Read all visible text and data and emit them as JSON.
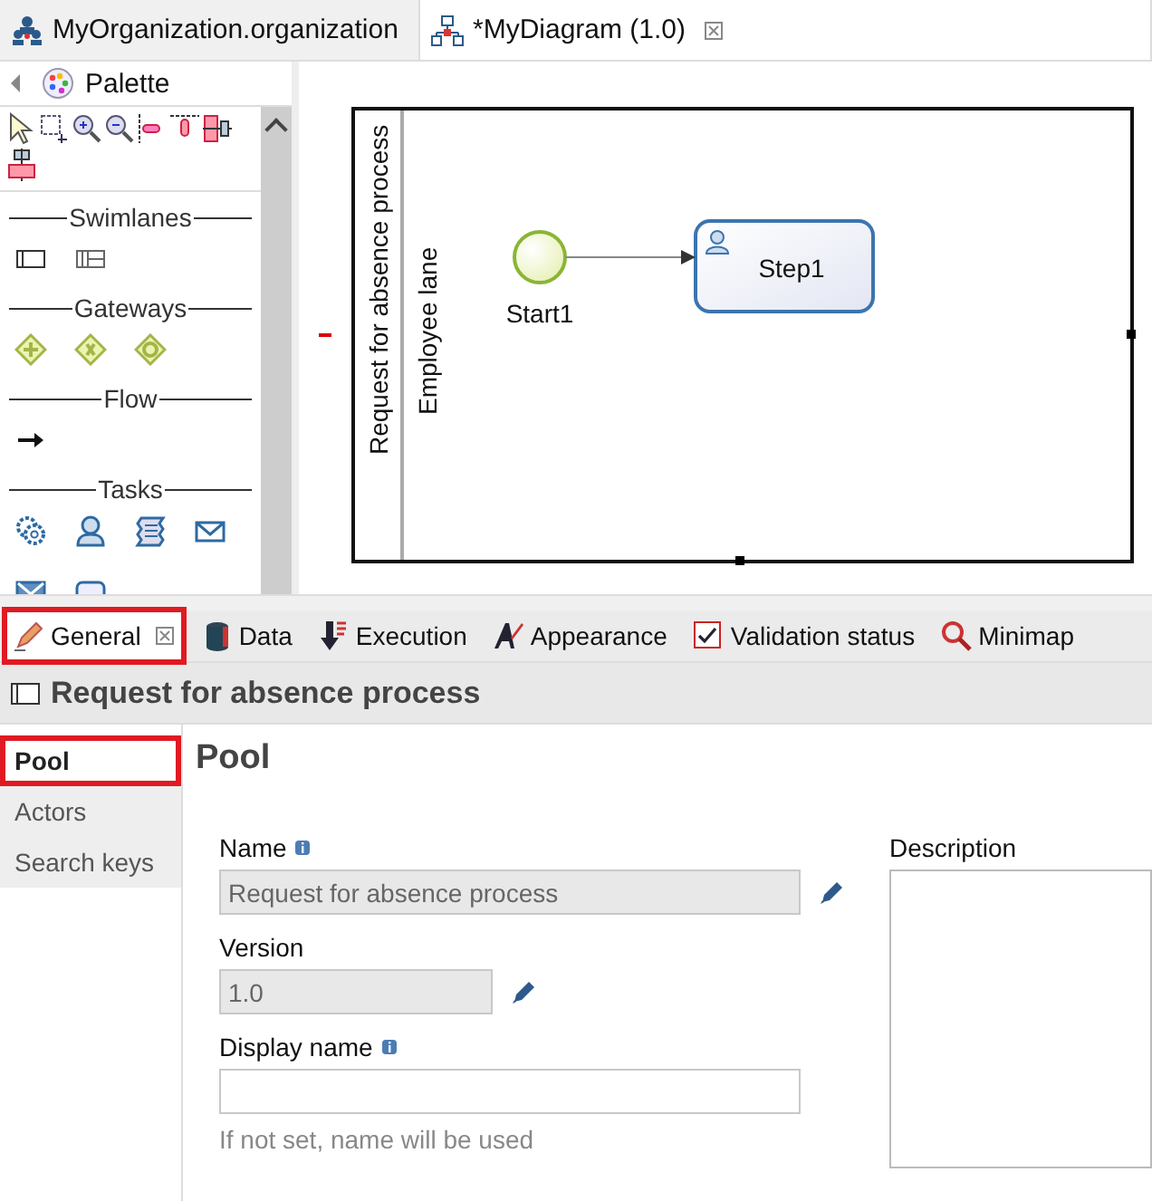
{
  "editor_tabs": [
    {
      "label": "MyOrganization.organization",
      "kind": "organization",
      "selected": false,
      "closable": false
    },
    {
      "label": "*MyDiagram (1.0)",
      "kind": "diagram",
      "selected": true,
      "closable": true
    }
  ],
  "palette": {
    "title": "Palette",
    "tools": [
      {
        "kind": "select"
      },
      {
        "kind": "marquee"
      },
      {
        "kind": "zoom-in"
      },
      {
        "kind": "zoom-out"
      },
      {
        "kind": "align-left"
      },
      {
        "kind": "align-top"
      },
      {
        "kind": "align-center"
      },
      {
        "kind": "align-middle"
      }
    ],
    "sections": [
      {
        "label": "Swimlanes",
        "tools": [
          {
            "kind": "pool"
          },
          {
            "kind": "lane"
          }
        ]
      },
      {
        "label": "Gateways",
        "tools": [
          {
            "kind": "parallel"
          },
          {
            "kind": "exclusive"
          },
          {
            "kind": "inclusive"
          }
        ]
      },
      {
        "label": "Flow",
        "tools": [
          {
            "kind": "sequence"
          }
        ]
      },
      {
        "label": "Tasks",
        "tools": [
          {
            "kind": "service"
          },
          {
            "kind": "human"
          },
          {
            "kind": "script"
          },
          {
            "kind": "receive"
          },
          {
            "kind": "send"
          },
          {
            "kind": "abstract"
          }
        ]
      }
    ]
  },
  "diagram": {
    "pool": {
      "label": "Request for absence process",
      "lanes": [
        {
          "label": "Employee lane"
        }
      ]
    },
    "nodes": [
      {
        "kind": "start",
        "label": "Start1"
      },
      {
        "kind": "human-task",
        "label": "Step1"
      }
    ]
  },
  "property_tabs": [
    {
      "label": "General",
      "kind": "general",
      "selected": true,
      "highlighted": true,
      "closable": true
    },
    {
      "label": "Data",
      "kind": "data",
      "selected": false,
      "highlighted": false,
      "closable": false
    },
    {
      "label": "Execution",
      "kind": "execution",
      "selected": false,
      "highlighted": false,
      "closable": false
    },
    {
      "label": "Appearance",
      "kind": "appearance",
      "selected": false,
      "highlighted": false,
      "closable": false
    },
    {
      "label": "Validation status",
      "kind": "validation",
      "selected": false,
      "highlighted": false,
      "closable": false
    },
    {
      "label": "Minimap",
      "kind": "minimap",
      "selected": false,
      "highlighted": false,
      "closable": false
    }
  ],
  "properties_header": "Request for absence process",
  "side_items": [
    {
      "label": "Pool",
      "selected": true,
      "highlighted": true
    },
    {
      "label": "Actors",
      "selected": false,
      "highlighted": false
    },
    {
      "label": "Search keys",
      "selected": false,
      "highlighted": false
    }
  ],
  "section_title": "Pool",
  "fields": [
    {
      "label": "Name",
      "info": true,
      "value": "Request for absence process",
      "disabled": true,
      "editable": true,
      "kind": "text"
    },
    {
      "label": "Version",
      "info": false,
      "value": "1.0",
      "disabled": true,
      "editable": true,
      "kind": "version"
    },
    {
      "label": "Display name",
      "info": true,
      "disabled": false,
      "editable": false,
      "kind": "text",
      "hint": "If not set, name will be used"
    }
  ],
  "description": {
    "label": "Description"
  }
}
